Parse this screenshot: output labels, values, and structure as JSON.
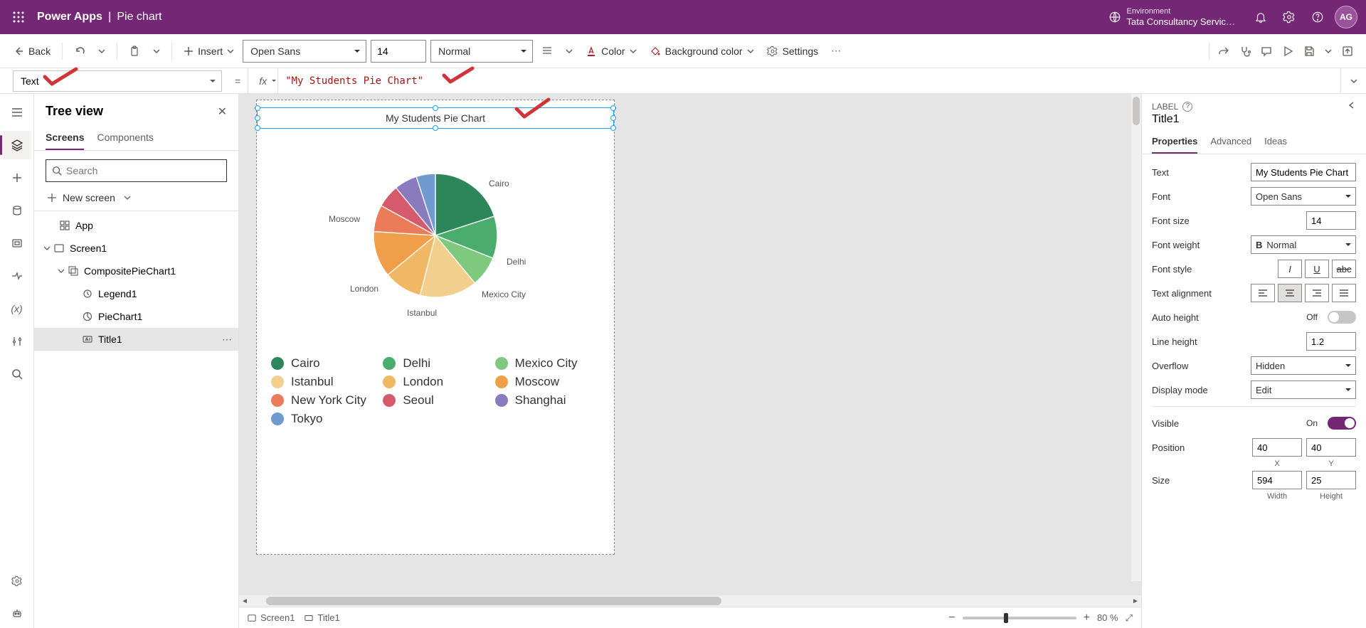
{
  "header": {
    "app": "Power Apps",
    "divider": "|",
    "page": "Pie chart",
    "env_label": "Environment",
    "env_name": "Tata Consultancy Servic…",
    "avatar": "AG"
  },
  "cmdbar": {
    "back": "Back",
    "insert": "Insert",
    "font": "Open Sans",
    "size": "14",
    "weight": "Normal",
    "color": "Color",
    "bgcolor": "Background color",
    "settings": "Settings"
  },
  "formula": {
    "prop": "Text",
    "value": "\"My Students Pie Chart\""
  },
  "tree": {
    "title": "Tree view",
    "tabs": {
      "screens": "Screens",
      "components": "Components"
    },
    "search_ph": "Search",
    "newscreen": "New screen",
    "items": {
      "app": "App",
      "screen1": "Screen1",
      "composite": "CompositePieChart1",
      "legend": "Legend1",
      "piechart": "PieChart1",
      "title1": "Title1"
    }
  },
  "canvas": {
    "title": "My Students Pie Chart",
    "bc_screen": "Screen1",
    "bc_title": "Title1",
    "zoom": "80",
    "zoom_pct": "%"
  },
  "chart_data": {
    "type": "pie",
    "title": "My Students Pie Chart",
    "series": [
      {
        "name": "Cairo",
        "value": 20,
        "color": "#2d8659"
      },
      {
        "name": "Delhi",
        "value": 11,
        "color": "#4aad6e"
      },
      {
        "name": "Mexico City",
        "value": 8,
        "color": "#7fc97f"
      },
      {
        "name": "Istanbul",
        "value": 15,
        "color": "#f2cf8d"
      },
      {
        "name": "London",
        "value": 10,
        "color": "#f0b864"
      },
      {
        "name": "Moscow",
        "value": 12,
        "color": "#ef9e4a"
      },
      {
        "name": "New York City",
        "value": 7,
        "color": "#eb7b59"
      },
      {
        "name": "Seoul",
        "value": 6,
        "color": "#d45a6c"
      },
      {
        "name": "Shanghai",
        "value": 6,
        "color": "#8a7bbf"
      },
      {
        "name": "Tokyo",
        "value": 5,
        "color": "#6f9bd1"
      }
    ],
    "labels_visible": [
      "Cairo",
      "Delhi",
      "Mexico City",
      "Istanbul",
      "London",
      "Moscow"
    ]
  },
  "rpanel": {
    "type": "LABEL",
    "name": "Title1",
    "tabs": {
      "properties": "Properties",
      "advanced": "Advanced",
      "ideas": "Ideas"
    },
    "props": {
      "text_l": "Text",
      "text_v": "My Students Pie Chart",
      "font_l": "Font",
      "font_v": "Open Sans",
      "fontsize_l": "Font size",
      "fontsize_v": "14",
      "fontweight_l": "Font weight",
      "fontweight_v": "Normal",
      "fontstyle_l": "Font style",
      "align_l": "Text alignment",
      "autoh_l": "Auto height",
      "autoh_v": "Off",
      "lineh_l": "Line height",
      "lineh_v": "1.2",
      "overflow_l": "Overflow",
      "overflow_v": "Hidden",
      "dmode_l": "Display mode",
      "dmode_v": "Edit",
      "visible_l": "Visible",
      "visible_v": "On",
      "pos_l": "Position",
      "pos_x": "40",
      "pos_y": "40",
      "x_l": "X",
      "y_l": "Y",
      "size_l": "Size",
      "size_w": "594",
      "size_h": "25",
      "w_l": "Width",
      "h_l": "Height"
    }
  }
}
